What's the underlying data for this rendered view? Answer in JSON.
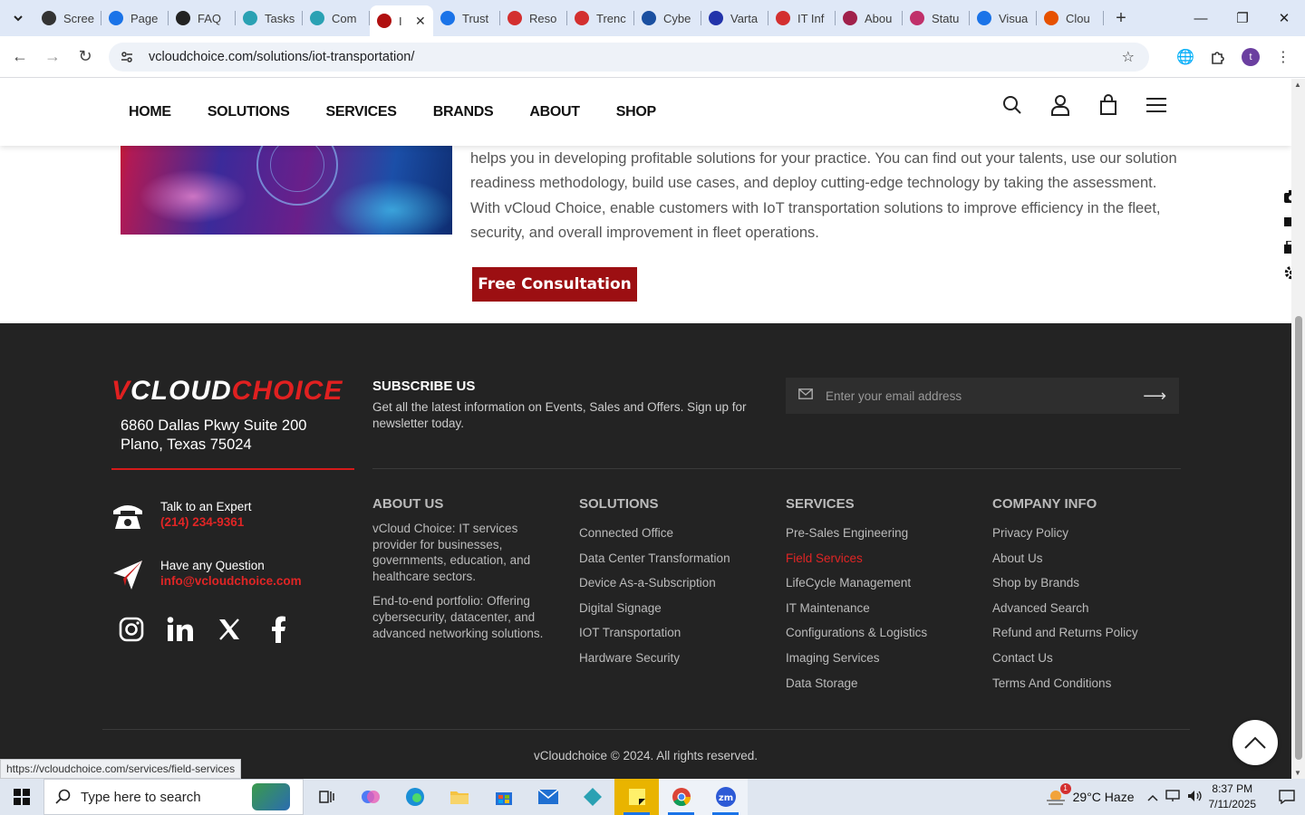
{
  "browser": {
    "tabs": [
      {
        "label": "Scree",
        "color": "#333333"
      },
      {
        "label": "Page",
        "color": "#1a73e8"
      },
      {
        "label": "FAQ",
        "color": "#222222"
      },
      {
        "label": "Tasks",
        "color": "#2aa1b3"
      },
      {
        "label": "Com",
        "color": "#2aa1b3"
      },
      {
        "label": "I",
        "color": "#b01010",
        "active": true
      },
      {
        "label": "Trust",
        "color": "#1a73e8"
      },
      {
        "label": "Reso",
        "color": "#d32f2f"
      },
      {
        "label": "Trenc",
        "color": "#d32f2f"
      },
      {
        "label": "Cybe",
        "color": "#1a4fa0"
      },
      {
        "label": "Varta",
        "color": "#2233aa"
      },
      {
        "label": "IT Inf",
        "color": "#d32f2f"
      },
      {
        "label": "Abou",
        "color": "#a0204a"
      },
      {
        "label": "Statu",
        "color": "#c0306a"
      },
      {
        "label": "Visua",
        "color": "#1a73e8"
      },
      {
        "label": "Clou",
        "color": "#e65100"
      }
    ],
    "url": "vcloudchoice.com/solutions/iot-transportation/",
    "profile_initial": "t",
    "status_url": "https://vcloudchoice.com/services/field-services"
  },
  "nav": {
    "items": [
      "HOME",
      "SOLUTIONS",
      "SERVICES",
      "BRANDS",
      "ABOUT",
      "SHOP"
    ]
  },
  "hero": {
    "text": "helps you in developing profitable solutions for your practice. You can find out your talents, use our solution readiness methodology, build use cases, and deploy cutting-edge technology by taking the assessment. With vCloud Choice, enable customers with IoT transportation solutions to improve efficiency in the fleet, security, and overall improvement in fleet operations.",
    "cta": "Free Consultation"
  },
  "footer": {
    "logo": {
      "v": "V",
      "cloud": "CLOUD",
      "choice": "CHOICE"
    },
    "address_line1": "6860 Dallas Pkwy Suite 200",
    "address_line2": "Plano, Texas 75024",
    "expert_label": "Talk to an Expert",
    "expert_phone": "(214) 234-9361",
    "question_label": "Have any Question",
    "question_email": "info@vcloudchoice.com",
    "subscribe_title": "SUBSCRIBE US",
    "subscribe_text": "Get all the latest information on Events, Sales and Offers. Sign up for newsletter today.",
    "email_placeholder": "Enter your email address",
    "about": {
      "title": "ABOUT US",
      "p1": "vCloud Choice: IT services provider for businesses, governments, education, and healthcare sectors.",
      "p2": "End-to-end portfolio: Offering cybersecurity, datacenter, and advanced networking solutions."
    },
    "solutions": {
      "title": "SOLUTIONS",
      "links": [
        "Connected Office",
        "Data Center Transformation",
        "Device As-a-Subscription",
        "Digital Signage",
        "IOT Transportation",
        "Hardware Security"
      ]
    },
    "services": {
      "title": "SERVICES",
      "links": [
        "Pre-Sales Engineering",
        "Field Services",
        "LifeCycle Management",
        "IT Maintenance",
        "Configurations & Logistics",
        "Imaging Services",
        "Data Storage"
      ]
    },
    "company": {
      "title": "COMPANY INFO",
      "links": [
        "Privacy Policy",
        "About Us",
        "Shop by Brands",
        "Advanced Search",
        "Refund and Returns Policy",
        "Contact Us",
        "Terms And Conditions"
      ]
    },
    "copyright": "vCloudchoice © 2024. All rights reserved."
  },
  "taskbar": {
    "search_placeholder": "Type here to search",
    "weather": "29°C  Haze",
    "time": "8:37 PM",
    "date": "7/11/2025",
    "weather_badge": "1"
  }
}
